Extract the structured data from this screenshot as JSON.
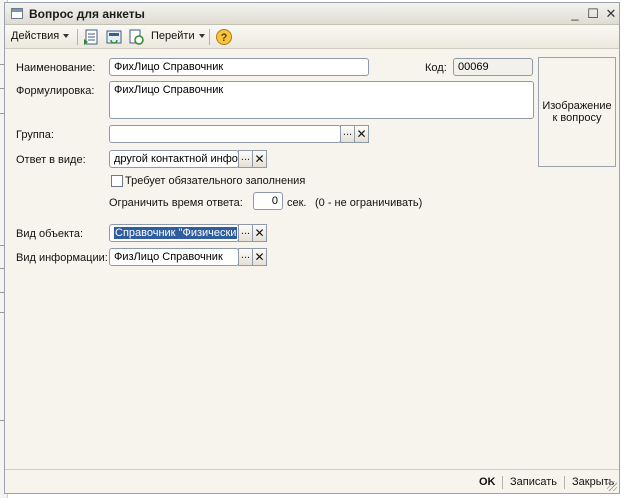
{
  "window": {
    "title": "Вопрос для анкеты",
    "minimize_glyph": "_",
    "maximize_glyph": "☐",
    "close_glyph": "✕"
  },
  "toolbar": {
    "actions_label": "Действия",
    "goto_label": "Перейти",
    "icons": [
      "list-icon",
      "save-refresh-icon",
      "copy-refresh-icon",
      "help-icon"
    ],
    "help_glyph": "?"
  },
  "form": {
    "name_label": "Наименование:",
    "name_value": "ФихЛицо Справочник",
    "code_label": "Код:",
    "code_value": "00069",
    "wording_label": "Формулировка:",
    "wording_value": "ФихЛицо Справочник",
    "image_button_line1": "Изображение",
    "image_button_line2": "к вопросу",
    "group_label": "Группа:",
    "group_value": "",
    "answer_label": "Ответ в виде:",
    "answer_value": "другой контактной инфо",
    "required_label": "Требует обязательного заполнения",
    "required_checked": false,
    "time_limit_label": "Ограничить время ответа:",
    "time_limit_value": "0",
    "time_unit": "сек.",
    "time_hint": "(0 - не ограничивать)",
    "object_type_label": "Вид объекта:",
    "object_type_value": "Справочник \"Физически",
    "info_type_label": "Вид информации:",
    "info_type_value": "ФизЛицо Справочник",
    "select_glyph": "...",
    "clear_glyph": "✕"
  },
  "footer": {
    "ok_label": "OK",
    "save_label": "Записать",
    "close_label": "Закрыть"
  },
  "colors": {
    "window_bg": "#f6f4ec",
    "selection": "#2f5d9e",
    "border": "#8f9aa8"
  }
}
